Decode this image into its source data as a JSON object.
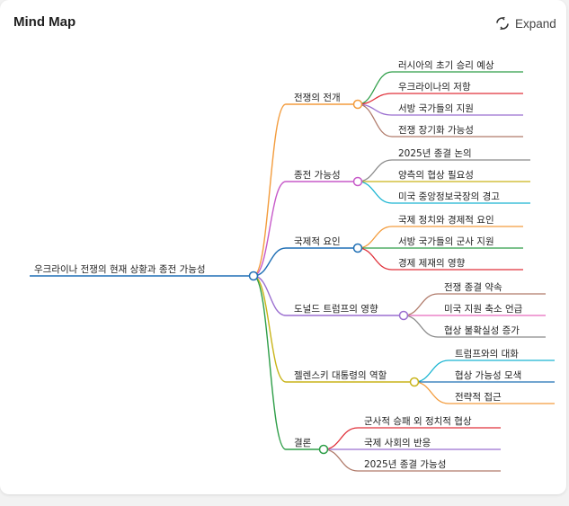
{
  "header": {
    "title": "Mind Map",
    "expand_label": "Expand",
    "expand_icon": "expand-icon"
  },
  "mindmap": {
    "root": {
      "label": "우크라이나 전쟁의 현재 상황과 종전 가능성",
      "color": "#1f6fb5"
    },
    "branches": [
      {
        "label": "전쟁의 전개",
        "color": "#f39c3d",
        "children": [
          {
            "label": "러시아의 초기 승리 예상",
            "color": "#2e9e48"
          },
          {
            "label": "우크라이나의 저항",
            "color": "#e0303a"
          },
          {
            "label": "서방 국가들의 지원",
            "color": "#9b6fd0"
          },
          {
            "label": "전쟁 장기화 가능성",
            "color": "#b07a6a"
          }
        ]
      },
      {
        "label": "종전 가능성",
        "color": "#c75ac9",
        "children": [
          {
            "label": "2025년 종결 논의",
            "color": "#8a8a8a"
          },
          {
            "label": "양측의 협상 필요성",
            "color": "#c9b419"
          },
          {
            "label": "미국 중앙정보국장의 경고",
            "color": "#1bb5d2"
          }
        ]
      },
      {
        "label": "국제적 요인",
        "color": "#1f6fb5",
        "children": [
          {
            "label": "국제 정치와 경제적 요인",
            "color": "#f39c3d"
          },
          {
            "label": "서방 국가들의 군사 지원",
            "color": "#2e9e48"
          },
          {
            "label": "경제 제재의 영향",
            "color": "#e0303a"
          }
        ]
      },
      {
        "label": "도널드 트럼프의 영향",
        "color": "#9b6fd0",
        "children": [
          {
            "label": "전쟁 종결 약속",
            "color": "#b07a6a"
          },
          {
            "label": "미국 지원 축소 언급",
            "color": "#e86bbd"
          },
          {
            "label": "협상 불확실성 증가",
            "color": "#8a8a8a"
          }
        ]
      },
      {
        "label": "젤렌스키 대통령의 역할",
        "color": "#c9b419",
        "children": [
          {
            "label": "트럼프와의 대화",
            "color": "#1bb5d2"
          },
          {
            "label": "협상 가능성 모색",
            "color": "#1f6fb5"
          },
          {
            "label": "전략적 접근",
            "color": "#f39c3d"
          }
        ]
      },
      {
        "label": "결론",
        "color": "#2e9e48",
        "children": [
          {
            "label": "군사적 승패 외 정치적 협상",
            "color": "#e0303a"
          },
          {
            "label": "국제 사회의 반응",
            "color": "#9b6fd0"
          },
          {
            "label": "2025년 종결 가능성",
            "color": "#b07a6a"
          }
        ]
      }
    ]
  }
}
